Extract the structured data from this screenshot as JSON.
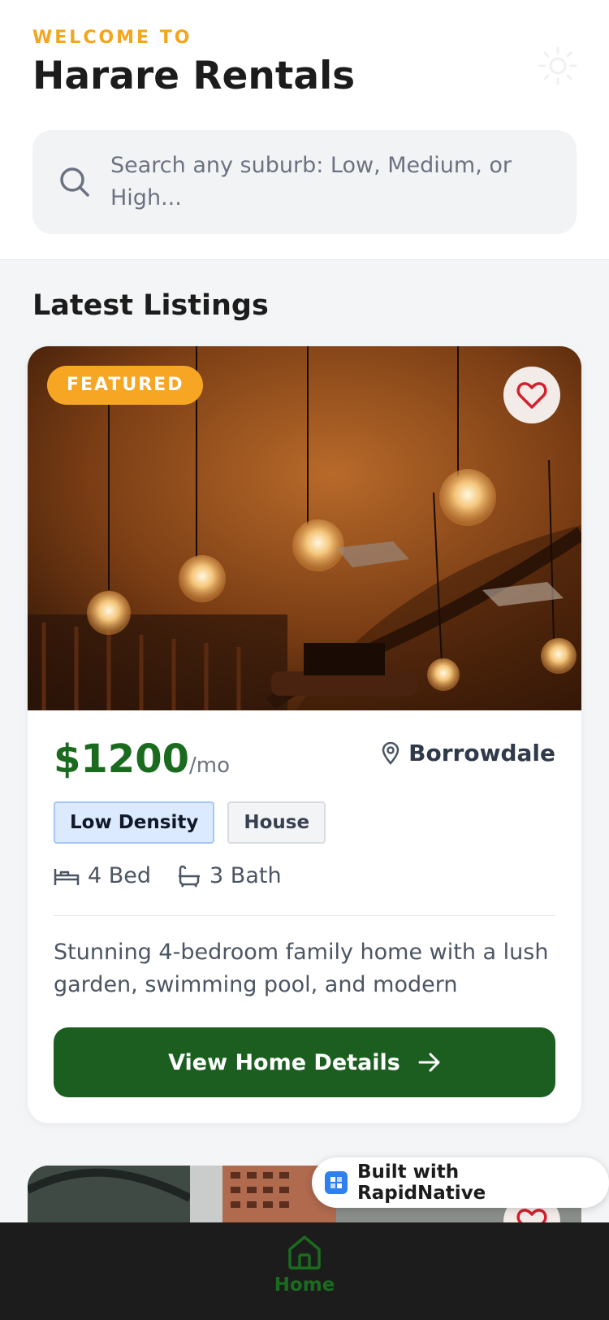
{
  "header": {
    "eyebrow": "WELCOME TO",
    "title": "Harare Rentals",
    "theme_icon": "sun-icon"
  },
  "search": {
    "placeholder": "Search any suburb: Low, Medium, or High..."
  },
  "section": {
    "title": "Latest Listings"
  },
  "listings": [
    {
      "badge": "FEATURED",
      "price": "$1200",
      "period": "/mo",
      "location": "Borrowdale",
      "tags": [
        "Low Density",
        "House"
      ],
      "beds": "4 Bed",
      "baths": "3 Bath",
      "description": "Stunning 4-bedroom family home with a lush garden, swimming pool, and modern finishes....",
      "cta": "View Home Details"
    }
  ],
  "badge": {
    "label": "Built with RapidNative"
  },
  "tabbar": {
    "home_label": "Home"
  },
  "colors": {
    "accent_orange": "#f4a51c",
    "brand_green": "#1b5e20",
    "price_green": "#1b6b1f",
    "tabbar_bg": "#1c1c1c"
  }
}
